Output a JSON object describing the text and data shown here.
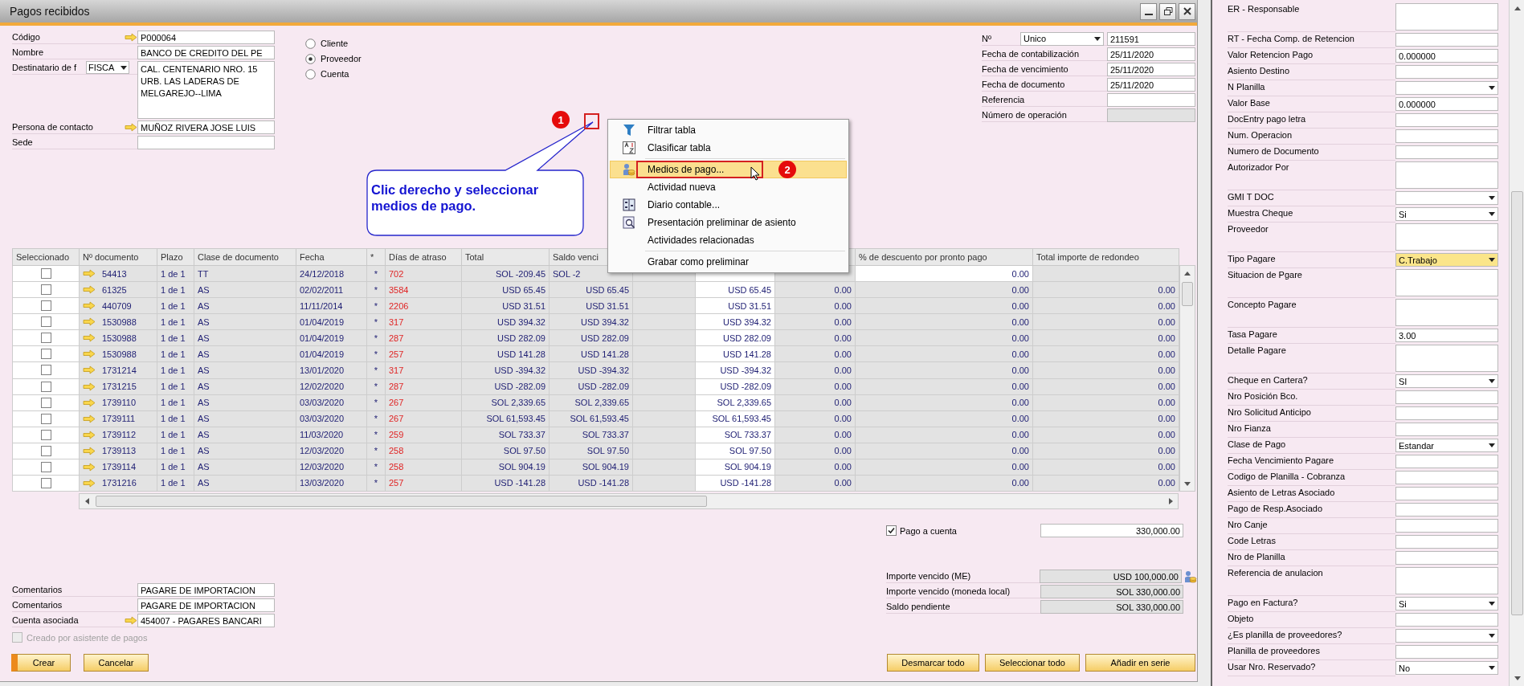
{
  "window": {
    "title": "Pagos recibidos"
  },
  "partner": {
    "fields": [
      {
        "kind": "link",
        "label": "Código",
        "value": "P000064"
      },
      {
        "kind": "text",
        "label": "Nombre",
        "value": "BANCO DE CREDITO DEL PE"
      },
      {
        "kind": "address",
        "label": "Destinatario de f",
        "select": "FISCA",
        "lines": [
          "CAL. CENTENARIO NRO. 15",
          "URB. LAS LADERAS DE",
          "MELGAREJO--LIMA"
        ]
      },
      {
        "kind": "link",
        "label": "Persona de contacto",
        "value": "MUÑOZ RIVERA JOSE LUIS"
      },
      {
        "kind": "text",
        "label": "Sede"
      }
    ],
    "type_options": [
      {
        "label": "Cliente",
        "selected": false
      },
      {
        "label": "Proveedor",
        "selected": true
      },
      {
        "label": "Cuenta",
        "selected": false
      }
    ]
  },
  "document": {
    "fields": [
      {
        "kind": "series",
        "label": "Nº",
        "select": "Unico",
        "value": "211591"
      },
      {
        "kind": "text",
        "label": "Fecha de contabilización",
        "value": "25/11/2020"
      },
      {
        "kind": "text",
        "label": "Fecha de vencimiento",
        "value": "25/11/2020"
      },
      {
        "kind": "text",
        "label": "Fecha de documento",
        "value": "25/11/2020"
      },
      {
        "kind": "text",
        "label": "Referencia"
      },
      {
        "kind": "disabled",
        "label": "Número de operación"
      }
    ]
  },
  "annotations": {
    "callout": "Clic derecho y seleccionar medios de pago.",
    "badges": [
      "1",
      "2"
    ]
  },
  "context_menu": {
    "groups": [
      [
        {
          "label": "Filtrar tabla",
          "selected": false
        },
        {
          "label": "Clasificar tabla",
          "selected": false
        }
      ],
      [
        {
          "label": "Medios de pago...",
          "selected": true
        },
        {
          "label": "Actividad nueva",
          "selected": false
        },
        {
          "label": "Diario contable...",
          "selected": false
        },
        {
          "label": "Presentación preliminar de asiento",
          "selected": false
        },
        {
          "label": "Actividades relacionadas",
          "selected": false
        }
      ],
      [
        {
          "label": "Grabar como preliminar",
          "selected": false
        }
      ]
    ]
  },
  "table": {
    "checkbox_column": "Seleccionado",
    "columns": [
      "Nº documento",
      "Plazo",
      "Clase de documento",
      "Fecha",
      "*",
      "Días de atraso",
      "Total",
      "Saldo venci",
      null,
      null,
      null,
      "% de descuento por pronto pago",
      "Total importe de redondeo"
    ],
    "rows": [
      {
        "checked": false,
        "discount_editable": true,
        "cells": [
          "54413",
          "1 de 1",
          "TT",
          "24/12/2018",
          "*",
          "702",
          "SOL -209.45",
          "SOL -2",
          null,
          null,
          null,
          "0.00",
          null
        ]
      },
      {
        "checked": false,
        "discount_editable": false,
        "cells": [
          "61325",
          "1 de 1",
          "AS",
          "02/02/2011",
          "*",
          "3584",
          "USD 65.45",
          "USD 65.45",
          null,
          "USD 65.45",
          "0.00",
          "0.00",
          "0.00"
        ]
      },
      {
        "checked": false,
        "discount_editable": false,
        "cells": [
          "440709",
          "1 de 1",
          "AS",
          "11/11/2014",
          "*",
          "2206",
          "USD 31.51",
          "USD 31.51",
          null,
          "USD 31.51",
          "0.00",
          "0.00",
          "0.00"
        ]
      },
      {
        "checked": false,
        "discount_editable": false,
        "cells": [
          "1530988",
          "1 de 1",
          "AS",
          "01/04/2019",
          "*",
          "317",
          "USD 394.32",
          "USD 394.32",
          null,
          "USD 394.32",
          "0.00",
          "0.00",
          "0.00"
        ]
      },
      {
        "checked": false,
        "discount_editable": false,
        "cells": [
          "1530988",
          "1 de 1",
          "AS",
          "01/04/2019",
          "*",
          "287",
          "USD 282.09",
          "USD 282.09",
          null,
          "USD 282.09",
          "0.00",
          "0.00",
          "0.00"
        ]
      },
      {
        "checked": false,
        "discount_editable": false,
        "cells": [
          "1530988",
          "1 de 1",
          "AS",
          "01/04/2019",
          "*",
          "257",
          "USD 141.28",
          "USD 141.28",
          null,
          "USD 141.28",
          "0.00",
          "0.00",
          "0.00"
        ]
      },
      {
        "checked": false,
        "discount_editable": false,
        "cells": [
          "1731214",
          "1 de 1",
          "AS",
          "13/01/2020",
          "*",
          "317",
          "USD -394.32",
          "USD -394.32",
          null,
          "USD -394.32",
          "0.00",
          "0.00",
          "0.00"
        ]
      },
      {
        "checked": false,
        "discount_editable": false,
        "cells": [
          "1731215",
          "1 de 1",
          "AS",
          "12/02/2020",
          "*",
          "287",
          "USD -282.09",
          "USD -282.09",
          null,
          "USD -282.09",
          "0.00",
          "0.00",
          "0.00"
        ]
      },
      {
        "checked": false,
        "discount_editable": false,
        "cells": [
          "1739110",
          "1 de 1",
          "AS",
          "03/03/2020",
          "*",
          "267",
          "SOL 2,339.65",
          "SOL 2,339.65",
          null,
          "SOL 2,339.65",
          "0.00",
          "0.00",
          "0.00"
        ]
      },
      {
        "checked": false,
        "discount_editable": false,
        "cells": [
          "1739111",
          "1 de 1",
          "AS",
          "03/03/2020",
          "*",
          "267",
          "SOL 61,593.45",
          "SOL 61,593.45",
          null,
          "SOL 61,593.45",
          "0.00",
          "0.00",
          "0.00"
        ]
      },
      {
        "checked": false,
        "discount_editable": false,
        "cells": [
          "1739112",
          "1 de 1",
          "AS",
          "11/03/2020",
          "*",
          "259",
          "SOL 733.37",
          "SOL 733.37",
          null,
          "SOL 733.37",
          "0.00",
          "0.00",
          "0.00"
        ]
      },
      {
        "checked": false,
        "discount_editable": false,
        "cells": [
          "1739113",
          "1 de 1",
          "AS",
          "12/03/2020",
          "*",
          "258",
          "SOL 97.50",
          "SOL 97.50",
          null,
          "SOL 97.50",
          "0.00",
          "0.00",
          "0.00"
        ]
      },
      {
        "checked": false,
        "discount_editable": false,
        "cells": [
          "1739114",
          "1 de 1",
          "AS",
          "12/03/2020",
          "*",
          "258",
          "SOL 904.19",
          "SOL 904.19",
          null,
          "SOL 904.19",
          "0.00",
          "0.00",
          "0.00"
        ]
      },
      {
        "checked": false,
        "discount_editable": false,
        "cells": [
          "1731216",
          "1 de 1",
          "AS",
          "13/03/2020",
          "*",
          "257",
          "USD -141.28",
          "USD -141.28",
          null,
          "USD -141.28",
          "0.00",
          "0.00",
          "0.00"
        ]
      }
    ]
  },
  "summary": {
    "on_account": {
      "label": "Pago a cuenta",
      "checked": true,
      "value": "330,000.00"
    },
    "totals": [
      {
        "label": "Importe vencido (ME)",
        "value": "USD 100,000.00"
      },
      {
        "label": "Importe vencido (moneda local)",
        "value": "SOL 330,000.00"
      },
      {
        "label": "Saldo pendiente",
        "value": "SOL 330,000.00"
      }
    ]
  },
  "remarks": {
    "fields": [
      {
        "kind": "text",
        "label": "Comentarios",
        "value": "PAGARE DE IMPORTACION"
      },
      {
        "kind": "text",
        "label": "Comentarios",
        "value": "PAGARE DE IMPORTACION"
      },
      {
        "kind": "link",
        "label": "Cuenta asociada",
        "value": "454007 - PAGARES BANCARI"
      }
    ],
    "wizard": {
      "label": "Creado por asistente de pagos",
      "checked": false,
      "disabled": true
    }
  },
  "buttons_left": [
    {
      "label": "Crear",
      "kind": "primary"
    },
    {
      "label": "Cancelar",
      "kind": "normal"
    }
  ],
  "buttons_right": [
    {
      "label": "Desmarcar todo"
    },
    {
      "label": "Seleccionar todo"
    },
    {
      "label": "Añadir en serie"
    }
  ],
  "side_panel": {
    "fields": [
      {
        "label": "ER - Responsable",
        "kind": "area",
        "focused": false
      },
      {
        "label": "RT - Fecha Comp. de Retencion",
        "kind": "text",
        "focused": false
      },
      {
        "label": "Valor Retencion Pago",
        "kind": "text",
        "value": "0.000000",
        "focused": false
      },
      {
        "label": "Asiento Destino",
        "kind": "text",
        "focused": false
      },
      {
        "label": "N Planilla",
        "kind": "dropdown",
        "focused": false
      },
      {
        "label": "Valor Base",
        "kind": "text",
        "value": "0.000000",
        "focused": false
      },
      {
        "label": "DocEntry pago letra",
        "kind": "text",
        "focused": false
      },
      {
        "label": "Num. Operacion",
        "kind": "text",
        "focused": false
      },
      {
        "label": "Numero de Documento",
        "kind": "text",
        "focused": false
      },
      {
        "label": "Autorizador Por",
        "kind": "area",
        "focused": false
      },
      {
        "label": "GMI  T  DOC",
        "kind": "dropdown",
        "focused": false
      },
      {
        "label": "Muestra Cheque",
        "kind": "dropdown",
        "value": "Si",
        "focused": false
      },
      {
        "label": "Proveedor",
        "kind": "area",
        "focused": false
      },
      {
        "label": "Tipo Pagare",
        "kind": "dropdown",
        "value": "C.Trabajo",
        "focused": true
      },
      {
        "label": "Situacion de Pgare",
        "kind": "area",
        "focused": false
      },
      {
        "label": "Concepto Pagare",
        "kind": "area",
        "focused": false
      },
      {
        "label": "Tasa Pagare",
        "kind": "text",
        "value": "3.00",
        "focused": false
      },
      {
        "label": "Detalle Pagare",
        "kind": "area",
        "focused": false
      },
      {
        "label": "Cheque en Cartera?",
        "kind": "dropdown",
        "value": "SI",
        "focused": false
      },
      {
        "label": "Nro Posición Bco.",
        "kind": "text",
        "focused": false
      },
      {
        "label": "Nro Solicitud Anticipo",
        "kind": "text",
        "focused": false
      },
      {
        "label": "Nro Fianza",
        "kind": "text",
        "focused": false
      },
      {
        "label": "Clase de Pago",
        "kind": "dropdown",
        "value": "Estandar",
        "focused": false
      },
      {
        "label": "Fecha Vencimiento Pagare",
        "kind": "text",
        "focused": false
      },
      {
        "label": "Codigo de Planilla - Cobranza",
        "kind": "text",
        "focused": false
      },
      {
        "label": "Asiento de Letras Asociado",
        "kind": "text",
        "focused": false
      },
      {
        "label": "Pago de Resp.Asociado",
        "kind": "text",
        "focused": false
      },
      {
        "label": "Nro Canje",
        "kind": "text",
        "focused": false
      },
      {
        "label": "Code Letras",
        "kind": "text",
        "focused": false
      },
      {
        "label": "Nro de Planilla",
        "kind": "text",
        "focused": false
      },
      {
        "label": "Referencia de anulacion",
        "kind": "area",
        "focused": false
      },
      {
        "label": "Pago en Factura?",
        "kind": "dropdown",
        "value": "Si",
        "focused": false
      },
      {
        "label": "Objeto",
        "kind": "text",
        "focused": false
      },
      {
        "label": "¿Es planilla de proveedores?",
        "kind": "dropdown",
        "focused": false
      },
      {
        "label": "Planilla de proveedores",
        "kind": "text",
        "focused": false
      },
      {
        "label": "Usar Nro. Reservado?",
        "kind": "dropdown",
        "value": "No",
        "focused": false
      }
    ]
  }
}
